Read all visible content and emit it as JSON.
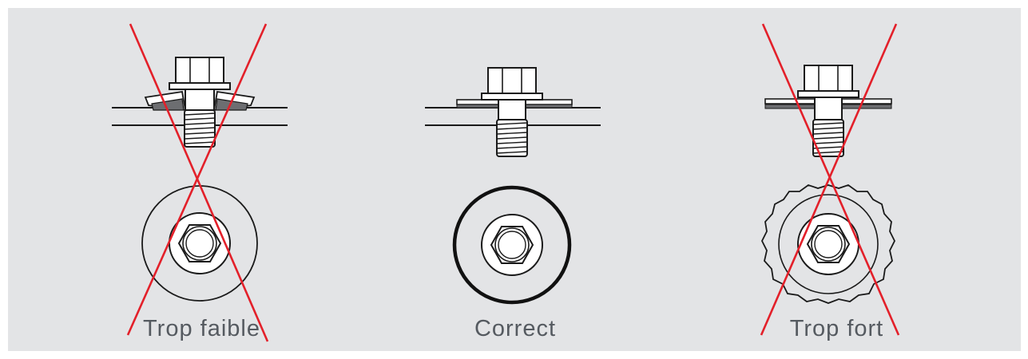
{
  "panels": [
    {
      "label": "Trop faible",
      "status": "incorrect"
    },
    {
      "label": "Correct",
      "status": "correct"
    },
    {
      "label": "Trop fort",
      "status": "incorrect"
    }
  ],
  "colors": {
    "background": "#e3e4e6",
    "line": "#1a1a1a",
    "cross": "#e3202a",
    "washer_fill": "#6d6e71",
    "text": "#555a60"
  },
  "icons": [
    "hex-bolt-icon",
    "washer-icon",
    "cross-mark-icon"
  ]
}
